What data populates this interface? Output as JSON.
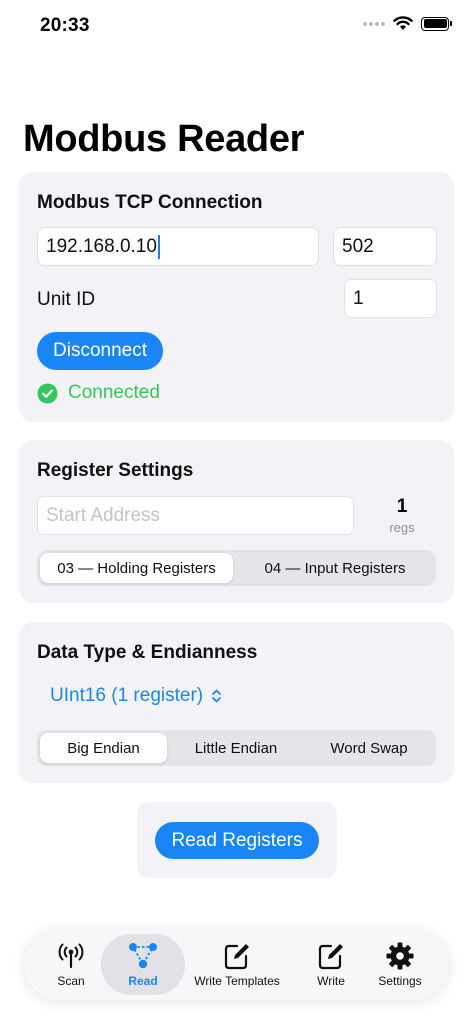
{
  "status_bar": {
    "time": "20:33"
  },
  "page": {
    "title": "Modbus Reader"
  },
  "connection": {
    "title": "Modbus TCP Connection",
    "host_value": "192.168.0.10",
    "port_value": "502",
    "unit_id_label": "Unit ID",
    "unit_id_value": "1",
    "disconnect_label": "Disconnect",
    "status_text": "Connected",
    "status_color": "#34c759"
  },
  "register_settings": {
    "title": "Register Settings",
    "start_address_placeholder": "Start Address",
    "count_value": "1",
    "count_unit": "regs",
    "types": [
      "03 — Holding Registers",
      "04 — Input Registers"
    ],
    "selected_type": "03 — Holding Registers"
  },
  "data_type": {
    "title": "Data Type & Endianness",
    "selected": "UInt16 (1 register)",
    "endianness": [
      "Big Endian",
      "Little Endian",
      "Word Swap"
    ],
    "selected_endianness": "Big Endian"
  },
  "read": {
    "button_label": "Read Registers"
  },
  "tabs": [
    {
      "label": "Scan",
      "icon": "antenna-icon"
    },
    {
      "label": "Read",
      "icon": "network-nodes-icon"
    },
    {
      "label": "Write Templates",
      "icon": "square-pencil-icon"
    },
    {
      "label": "Write",
      "icon": "square-pencil-icon"
    },
    {
      "label": "Settings",
      "icon": "gear-icon"
    }
  ],
  "active_tab": "Read",
  "colors": {
    "accent": "#1a86f5",
    "card_background": "#f2f2f7"
  }
}
